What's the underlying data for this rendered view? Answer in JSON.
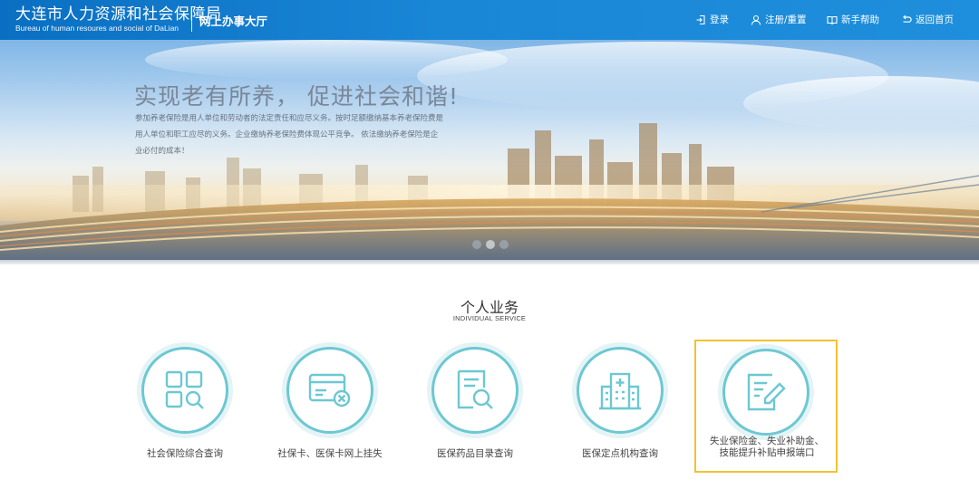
{
  "header": {
    "brand_cn": "大连市人力资源和社会保障局",
    "brand_en": "Bureau of human resoures and social of DaLian",
    "hall_title": "网上办事大厅",
    "nav": [
      {
        "label": "登录",
        "icon": "login-icon"
      },
      {
        "label": "注册/重置",
        "icon": "user-icon"
      },
      {
        "label": "新手帮助",
        "icon": "book-icon"
      },
      {
        "label": "返回首页",
        "icon": "return-icon"
      }
    ]
  },
  "banner": {
    "slogan": "实现老有所养， 促进社会和谐!",
    "description": "参加养老保险是用人单位和劳动者的法定责任和应尽义务。按时足额缴纳基本养老保险费是用人单位和职工应尽的义务。企业缴纳养老保险费体现公平竞争。 依法缴纳养老保险是企业必付的成本！",
    "slides": 3,
    "active_slide": 2
  },
  "section": {
    "title": "个人业务",
    "subtitle": "INDIVIDUAL SERVICE",
    "items": [
      {
        "label": "社会保险综合查询",
        "icon": "grid-search-icon"
      },
      {
        "label": "社保卡、医保卡网上挂失",
        "icon": "card-cancel-icon"
      },
      {
        "label": "医保药品目录查询",
        "icon": "document-search-icon"
      },
      {
        "label": "医保定点机构查询",
        "icon": "hospital-icon"
      },
      {
        "label_line1": "失业保险金、失业补助金、",
        "label_line2": "技能提升补贴申报端口",
        "icon": "form-edit-icon",
        "highlighted": true
      }
    ]
  },
  "colors": {
    "header_blue": "#1a86d6",
    "icon_teal": "#6cc8d2",
    "highlight_border": "#f3c22e"
  }
}
